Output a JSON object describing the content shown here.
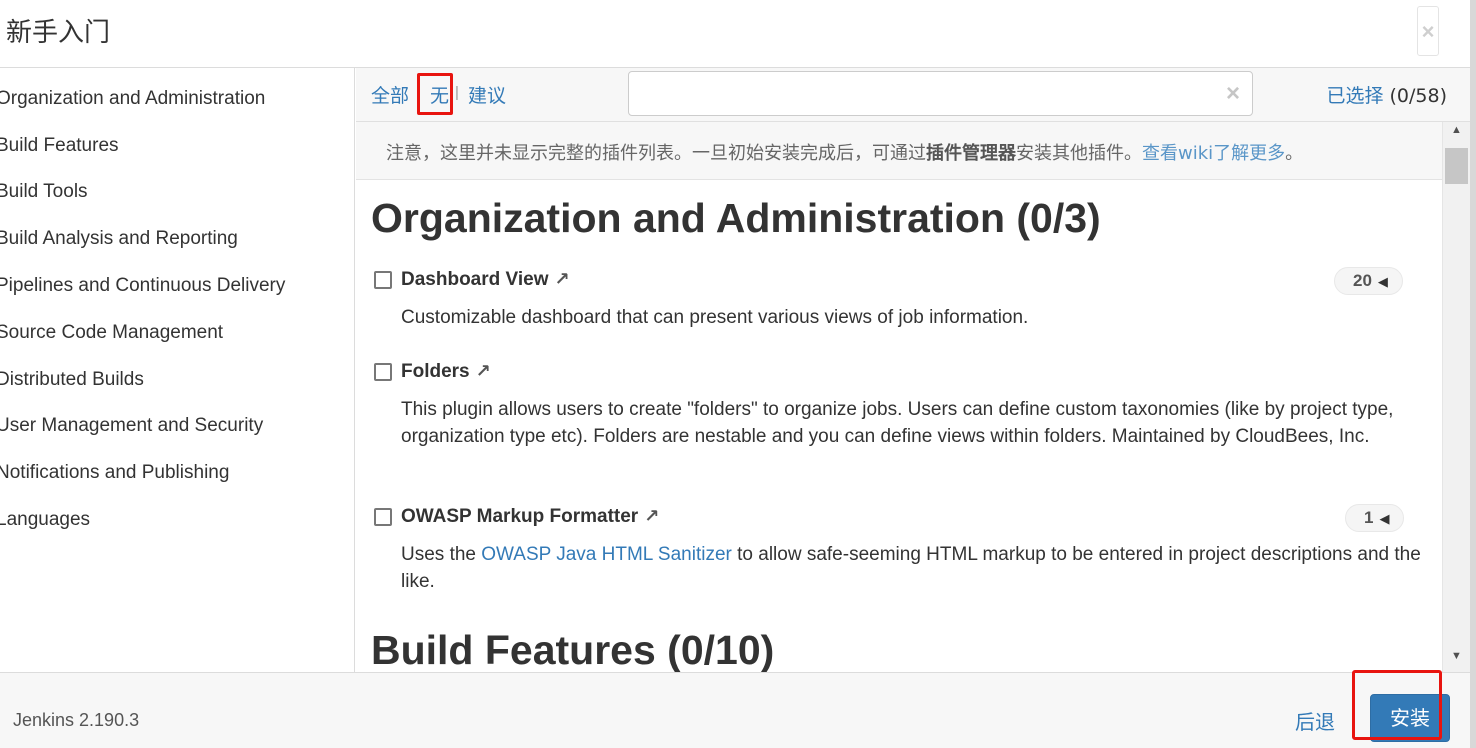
{
  "dialog": {
    "title": "新手入门",
    "close_symbol": "×"
  },
  "categories": [
    "Organization and Administration",
    "Build Features",
    "Build Tools",
    "Build Analysis and Reporting",
    "Pipelines and Continuous Delivery",
    "Source Code Management",
    "Distributed Builds",
    "User Management and Security",
    "Notifications and Publishing",
    "Languages"
  ],
  "toolbar": {
    "filters": [
      "全部",
      "无",
      "建议"
    ],
    "separator": "|",
    "search": {
      "value": "",
      "placeholder": "",
      "clear_symbol": "×"
    },
    "selected_label": "已选择",
    "selected_count": "(0/58)"
  },
  "notice": {
    "prefix": "注意，这里并未显示完整的插件列表。一旦初始安装完成后，可通过",
    "emphasis": "插件管理器",
    "middle": "安装其他插件。",
    "link": "查看wiki了解更多",
    "suffix": "。"
  },
  "sections": [
    {
      "title": "Organization and Administration (0/3)",
      "plugins": [
        {
          "name": "Dashboard View",
          "arrow": "↗",
          "badge": "20",
          "desc": "Customizable dashboard that can present various views of job information."
        },
        {
          "name": "Folders",
          "arrow": "↗",
          "badge": "",
          "desc": "This plugin allows users to create \"folders\" to organize jobs. Users can define custom taxonomies (like by project type, organization type etc). Folders are nestable and you can define views within folders. Maintained by CloudBees, Inc."
        },
        {
          "name": "OWASP Markup Formatter",
          "arrow": "↗",
          "badge": "1",
          "desc_prefix": "Uses the ",
          "desc_link": "OWASP Java HTML Sanitizer",
          "desc_suffix": " to allow safe-seeming HTML markup to be entered in project descriptions and the like."
        }
      ]
    },
    {
      "title": "Build Features (0/10)"
    }
  ],
  "badge_caret": "◀",
  "scrollbar": {
    "up": "▲",
    "down": "▼"
  },
  "footer": {
    "version": "Jenkins 2.190.3",
    "back": "后退",
    "install": "安装"
  },
  "colors": {
    "link": "#337ab7",
    "primary_button": "#337ab7",
    "highlight": "#e8140f"
  }
}
